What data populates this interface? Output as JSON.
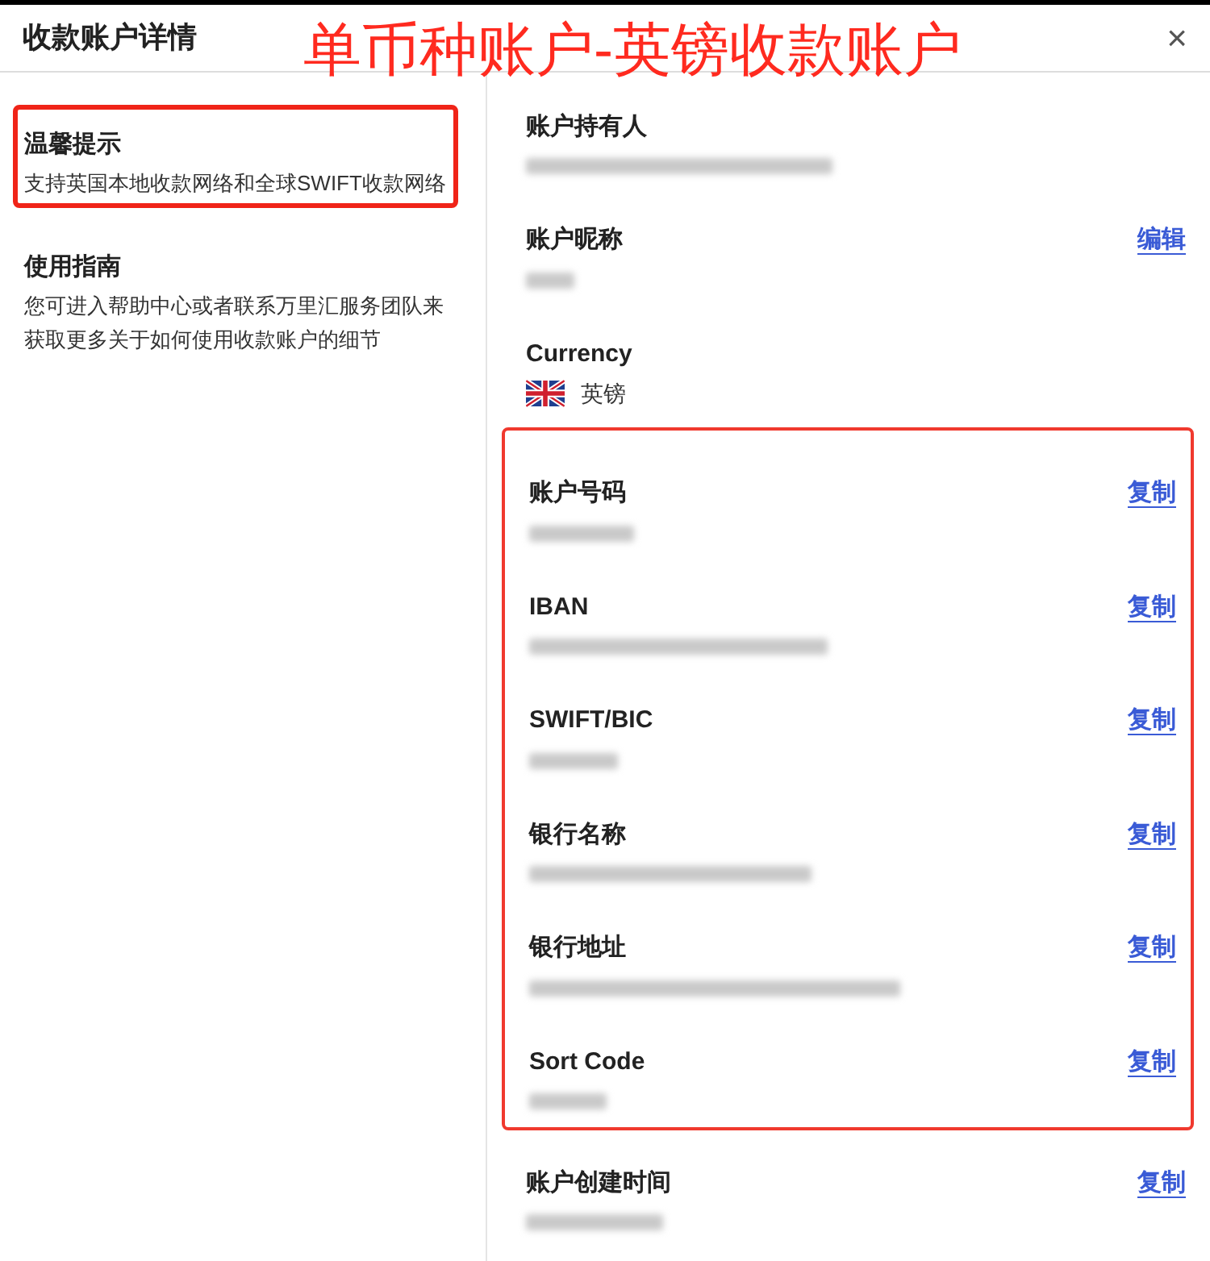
{
  "dialog": {
    "title": "收款账户详情",
    "close": "×"
  },
  "annotation": {
    "text": "单币种账户-英镑收款账户"
  },
  "sidebar": {
    "sections": [
      {
        "title": "温馨提示",
        "text": "支持英国本地收款网络和全球SWIFT收款网络",
        "highlighted": true
      },
      {
        "title": "使用指南",
        "text": "您可进入帮助中心或者联系万里汇服务团队来获取更多关于如何使用收款账户的细节",
        "highlighted": false
      }
    ]
  },
  "fields_before": [
    {
      "kind": "blurred",
      "label": "账户持有人"
    },
    {
      "kind": "blurred",
      "label": "账户昵称",
      "action": "编辑"
    },
    {
      "kind": "currency",
      "label": "Currency",
      "value": "英镑"
    }
  ],
  "highlighted_fields": [
    {
      "kind": "blurred",
      "label": "账户号码",
      "action": "复制"
    },
    {
      "kind": "blurred",
      "label": "IBAN",
      "action": "复制"
    },
    {
      "kind": "blurred",
      "label": "SWIFT/BIC",
      "action": "复制"
    },
    {
      "kind": "blurred",
      "label": "银行名称",
      "action": "复制"
    },
    {
      "kind": "blurred",
      "label": "银行地址",
      "action": "复制"
    },
    {
      "kind": "blurred",
      "label": "Sort Code",
      "action": "复制"
    }
  ],
  "fields_after": [
    {
      "kind": "blurred",
      "label": "账户创建时间",
      "action": "复制"
    }
  ]
}
